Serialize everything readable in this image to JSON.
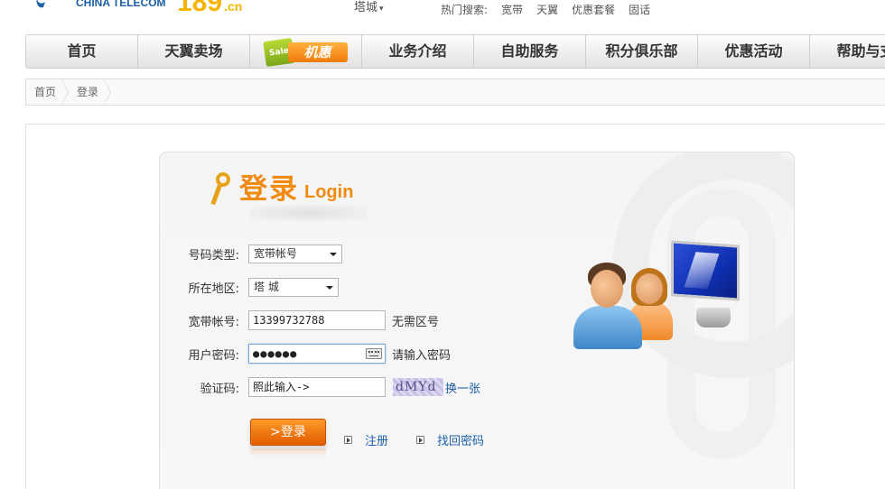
{
  "header": {
    "logo_text": "CHINA TELECOM",
    "logo_189": "189",
    "logo_189_suffix": ".cn",
    "city": "塔城",
    "hot_search_label": "热门搜索:",
    "hot_search_items": [
      "宽带",
      "天翼",
      "优惠套餐",
      "固话"
    ]
  },
  "nav": {
    "items": [
      "首页",
      "天翼卖场",
      "机惠",
      "业务介绍",
      "自助服务",
      "积分俱乐部",
      "优惠活动",
      "帮助与支"
    ],
    "promo_badge_text": "Sale"
  },
  "breadcrumb": [
    "首页",
    "登录"
  ],
  "login": {
    "title_cn": "登录",
    "title_en": "Login",
    "fields": {
      "account_type": {
        "label": "号码类型:",
        "value": "宽带帐号"
      },
      "region": {
        "label": "所在地区:",
        "value": "塔 城"
      },
      "account": {
        "label": "宽带帐号:",
        "value": "13399732788",
        "hint": "无需区号"
      },
      "password": {
        "label": "用户密码:",
        "value": "●●●●●●",
        "hint": "请输入密码"
      },
      "captcha": {
        "label": "验证码:",
        "value": "照此输入->",
        "image_text": "dMYd",
        "refresh_label": "换一张"
      }
    },
    "submit_label": ">登录",
    "register_label": "注册",
    "recover_label": "找回密码"
  },
  "colors": {
    "brand_blue": "#1a5fa8",
    "brand_orange": "#f08a10",
    "button_orange": "#e35b00"
  }
}
